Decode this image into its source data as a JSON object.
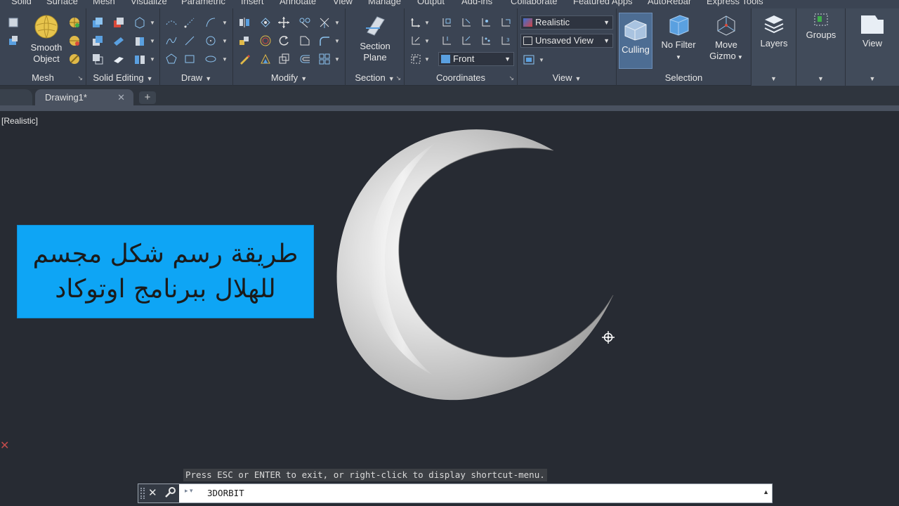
{
  "menu_tabs": [
    "Solid",
    "Surface",
    "Mesh",
    "Visualize",
    "Parametric",
    "Insert",
    "Annotate",
    "View",
    "Manage",
    "Output",
    "Add-ins",
    "Collaborate",
    "Featured Apps",
    "AutoRebar",
    "Express Tools"
  ],
  "ribbon": {
    "mesh": {
      "title": "Mesh",
      "smooth_object_line1": "Smooth",
      "smooth_object_line2": "Object"
    },
    "solid_editing": {
      "title": "Solid Editing"
    },
    "draw": {
      "title": "Draw"
    },
    "modify": {
      "title": "Modify"
    },
    "section": {
      "title": "Section",
      "section_plane_line1": "Section",
      "section_plane_line2": "Plane"
    },
    "coordinates": {
      "title": "Coordinates",
      "view_select": "Front"
    },
    "view": {
      "title": "View",
      "visual_style": "Realistic",
      "named_view": "Unsaved View"
    },
    "selection": {
      "title": "Selection",
      "culling": "Culling",
      "no_filter": "No Filter",
      "move_gizmo_line1": "Move",
      "move_gizmo_line2": "Gizmo"
    },
    "layers": {
      "title": "Layers"
    },
    "groups": {
      "title": "Groups"
    },
    "view_panel": {
      "title": "View"
    }
  },
  "file_tabs": {
    "active": "Drawing1*"
  },
  "viewport": {
    "label": "[Realistic]"
  },
  "banner": {
    "line1": "طريقة رسم شكل مجسم",
    "line2": "للهلال ببرنامج اوتوكاد"
  },
  "command": {
    "hint": "Press ESC or ENTER to exit, or right-click to display shortcut-menu.",
    "current": "3DORBIT"
  },
  "colors": {
    "accent_banner": "#0ea5f5",
    "ribbon_bg": "#3b4453",
    "canvas_bg": "#272b33"
  }
}
